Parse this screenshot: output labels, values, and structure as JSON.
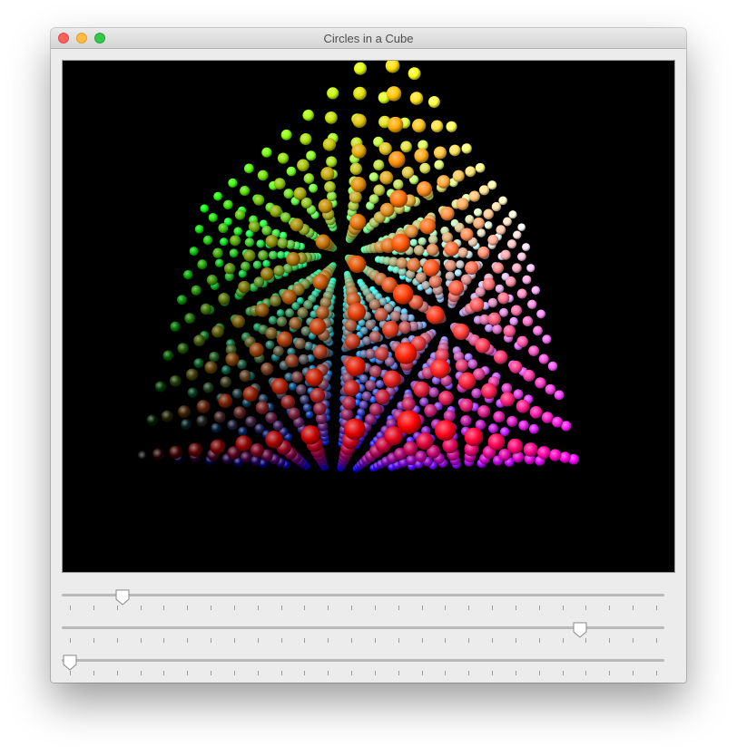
{
  "window": {
    "title": "Circles in a Cube"
  },
  "sliders": [
    {
      "name": "slider-1",
      "value": 0.09,
      "tick_count": 26
    },
    {
      "name": "slider-2",
      "value": 0.87,
      "tick_count": 26
    },
    {
      "name": "slider-3",
      "value": 0.0,
      "tick_count": 26
    }
  ],
  "cube": {
    "grid_size": 10,
    "rotation_y_deg": 40,
    "rotation_x_deg": 25,
    "background": "#000000"
  }
}
